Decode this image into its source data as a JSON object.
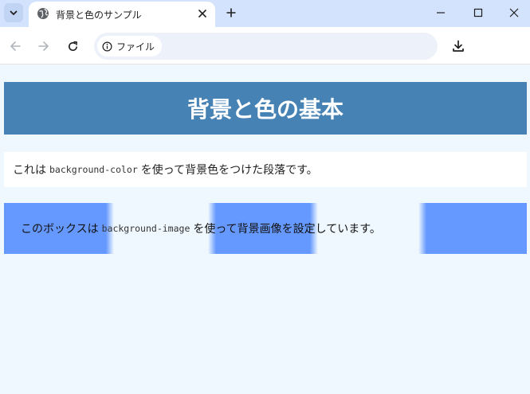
{
  "browser": {
    "tab_title": "背景と色のサンプル",
    "address_chip_label": "ファイル",
    "icons": {
      "tab_search": "chevron-down-icon",
      "favicon": "globe-icon",
      "tab_close": "close-icon",
      "new_tab": "plus-icon",
      "minimize": "minimize-icon",
      "maximize": "maximize-icon",
      "close_window": "close-icon",
      "back": "arrow-left-icon",
      "forward": "arrow-right-icon",
      "reload": "reload-icon",
      "site_info": "info-icon",
      "download": "download-icon"
    }
  },
  "page": {
    "heading": "背景と色の基本",
    "para1": {
      "before": "これは",
      "code": "background-color",
      "after": "を使って背景色をつけた段落です。"
    },
    "para2": {
      "before": "このボックスは",
      "code": "background-image",
      "after": "を使って背景画像を設定しています。"
    },
    "colors": {
      "page_background": "#f0f8ff",
      "heading_background": "#4682b4",
      "heading_text": "#ffffff",
      "paragraph_background": "#ffffff",
      "image_stripe": "#6699ff"
    }
  }
}
